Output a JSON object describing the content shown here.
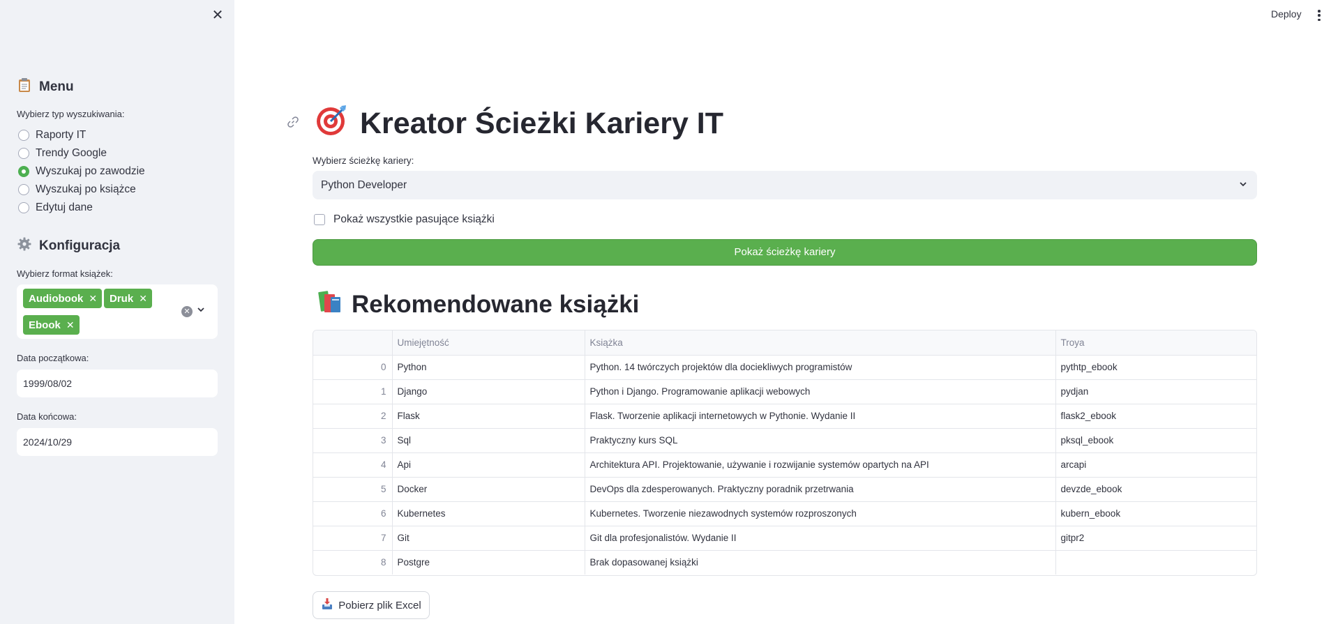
{
  "sidebar": {
    "menu_title": "Menu",
    "menu_icon": "clipboard-icon",
    "search_type_label": "Wybierz typ wyszukiwania:",
    "search_options": [
      "Raporty IT",
      "Trendy Google",
      "Wyszukaj po zawodzie",
      "Wyszukaj po książce",
      "Edytuj dane"
    ],
    "selected_search_option": "Wyszukaj po zawodzie",
    "config_title": "Konfiguracja",
    "config_icon": "gear-icon",
    "format_label": "Wybierz format książek:",
    "formats": [
      "Audiobook",
      "Druk",
      "Ebook"
    ],
    "start_date_label": "Data początkowa:",
    "start_date": "1999/08/02",
    "end_date_label": "Data końcowa:",
    "end_date": "2024/10/29"
  },
  "topbar": {
    "deploy_label": "Deploy"
  },
  "main": {
    "title": "Kreator Ścieżki Kariery IT",
    "title_icon": "target-icon",
    "career_label": "Wybierz ścieżkę kariery:",
    "career_value": "Python Developer",
    "show_all_label": "Pokaż wszystkie pasujące książki",
    "show_all_checked": false,
    "show_path_button": "Pokaż ścieżkę kariery",
    "section_title": "Rekomendowane książki",
    "section_icon": "books-icon",
    "download_button": "Pobierz plik Excel",
    "download_icon": "inbox-tray-icon"
  },
  "table": {
    "columns": [
      "",
      "Umiejętność",
      "Książka",
      "Troya"
    ],
    "rows": [
      [
        "0",
        "Python",
        "Python. 14 twórczych projektów dla dociekliwych programistów",
        "pythtp_ebook"
      ],
      [
        "1",
        "Django",
        "Python i Django. Programowanie aplikacji webowych",
        "pydjan"
      ],
      [
        "2",
        "Flask",
        "Flask. Tworzenie aplikacji internetowych w Pythonie. Wydanie II",
        "flask2_ebook"
      ],
      [
        "3",
        "Sql",
        "Praktyczny kurs SQL",
        "pksql_ebook"
      ],
      [
        "4",
        "Api",
        "Architektura API. Projektowanie, używanie i rozwijanie systemów opartych na API",
        "arcapi"
      ],
      [
        "5",
        "Docker",
        "DevOps dla zdesperowanych. Praktyczny poradnik przetrwania",
        "devzde_ebook"
      ],
      [
        "6",
        "Kubernetes",
        "Kubernetes. Tworzenie niezawodnych systemów rozproszonych",
        "kubern_ebook"
      ],
      [
        "7",
        "Git",
        "Git dla profesjonalistów. Wydanie II",
        "gitpr2"
      ],
      [
        "8",
        "Postgre",
        "Brak dopasowanej książki",
        ""
      ]
    ]
  },
  "colors": {
    "accent_green": "#5aaf4e",
    "sidebar_bg": "#f0f2f6",
    "text": "#31333f"
  }
}
